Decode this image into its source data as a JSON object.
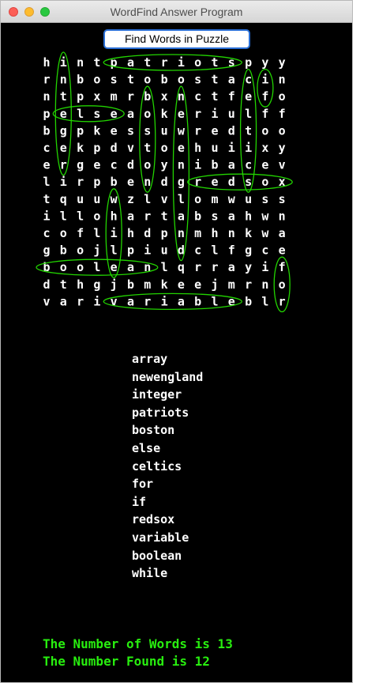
{
  "window": {
    "title": "WordFind Answer Program"
  },
  "toolbar": {
    "find_label": "Find Words in Puzzle"
  },
  "puzzle": {
    "rows": [
      "hintpatriotspyy",
      "rnbostobostacin",
      "ntpxmrbxnctfefo",
      "pelseaokeriulff",
      "bgpkessuwredtoo",
      "cekpdvtoehuiixy",
      "ergecdoynibacev",
      "lirpbendgredsox",
      "tquuwzlvlomwuss",
      "illohartabsahwn",
      "coflihdpnmhnkwa",
      "gbojlpiudclfgce",
      "booleanlqrrayif",
      "dthgjbmkeejmrno",
      "varivariableblr"
    ],
    "highlights": [
      {
        "word": "patriots",
        "from": [
          0,
          4
        ],
        "to": [
          0,
          11
        ]
      },
      {
        "word": "if",
        "from": [
          1,
          13
        ],
        "to": [
          2,
          13
        ]
      },
      {
        "word": "else",
        "from": [
          3,
          1
        ],
        "to": [
          3,
          4
        ]
      },
      {
        "word": "redsox",
        "from": [
          7,
          9
        ],
        "to": [
          7,
          14
        ]
      },
      {
        "word": "boolean",
        "from": [
          12,
          0
        ],
        "to": [
          12,
          6
        ]
      },
      {
        "word": "variable",
        "from": [
          14,
          4
        ],
        "to": [
          14,
          11
        ]
      },
      {
        "word": "integer",
        "from": [
          0,
          1
        ],
        "to": [
          6,
          1
        ]
      },
      {
        "word": "boston",
        "from": [
          2,
          6
        ],
        "to": [
          7,
          6
        ]
      },
      {
        "word": "newengland",
        "from": [
          2,
          8
        ],
        "to": [
          11,
          8
        ]
      },
      {
        "word": "while",
        "from": [
          8,
          4
        ],
        "to": [
          12,
          4
        ]
      },
      {
        "word": "celtics",
        "from": [
          1,
          12
        ],
        "to": [
          7,
          12
        ]
      },
      {
        "word": "for",
        "from": [
          12,
          14
        ],
        "to": [
          14,
          14
        ]
      }
    ]
  },
  "word_list": [
    "array",
    "newengland",
    "integer",
    "patriots",
    "boston",
    "else",
    "celtics",
    "for",
    "if",
    "redsox",
    "variable",
    "boolean",
    "while"
  ],
  "status": {
    "total": "The Number of Words is 13",
    "found": "The Number Found is 12"
  },
  "colors": {
    "ring": "#22d400",
    "status_text": "#28ee0f",
    "background": "#000000"
  }
}
